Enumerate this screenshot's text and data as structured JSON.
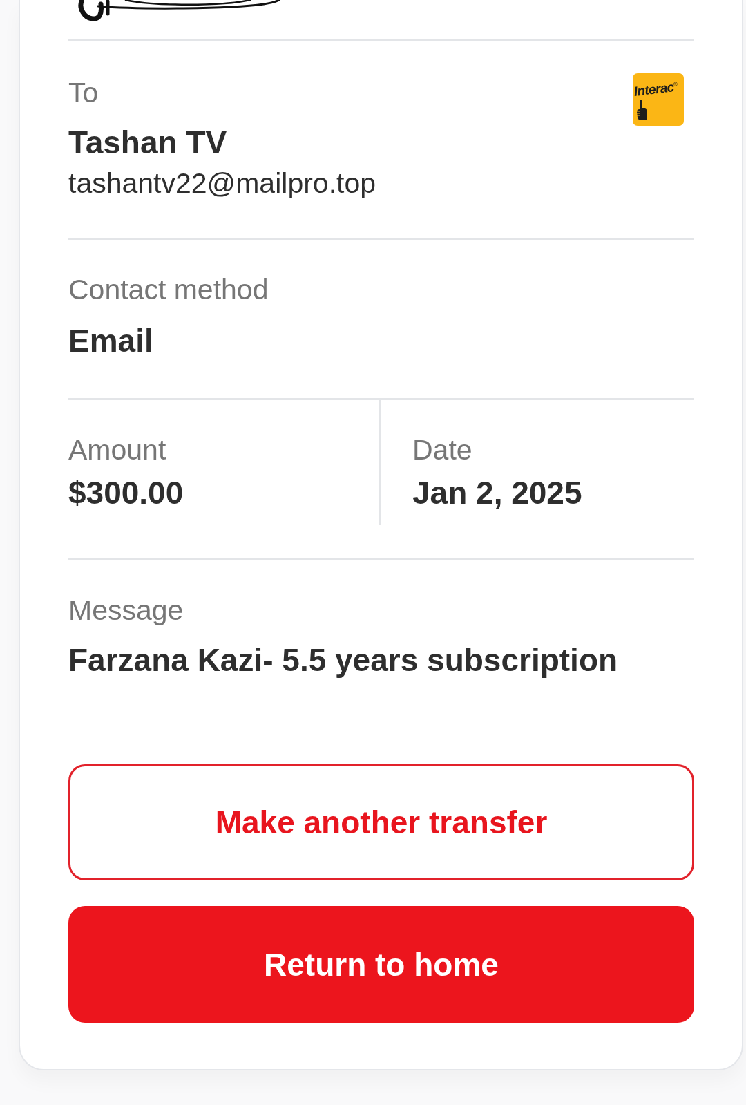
{
  "recipient": {
    "label": "To",
    "name": "Tashan TV",
    "email": "tashantv22@mailpro.top",
    "logo_text": "Interac",
    "logo_mark": "®"
  },
  "contact_method": {
    "label": "Contact method",
    "value": "Email"
  },
  "summary": [
    {
      "label": "Amount",
      "value": "$300.00"
    },
    {
      "label": "Date",
      "value": "Jan 2, 2025"
    }
  ],
  "message": {
    "label": "Message",
    "value": "Farzana Kazi- 5.5 years subscription"
  },
  "buttons": [
    {
      "label": "Make another transfer",
      "kind": "outline"
    },
    {
      "label": "Return to home",
      "kind": "filled"
    }
  ]
}
